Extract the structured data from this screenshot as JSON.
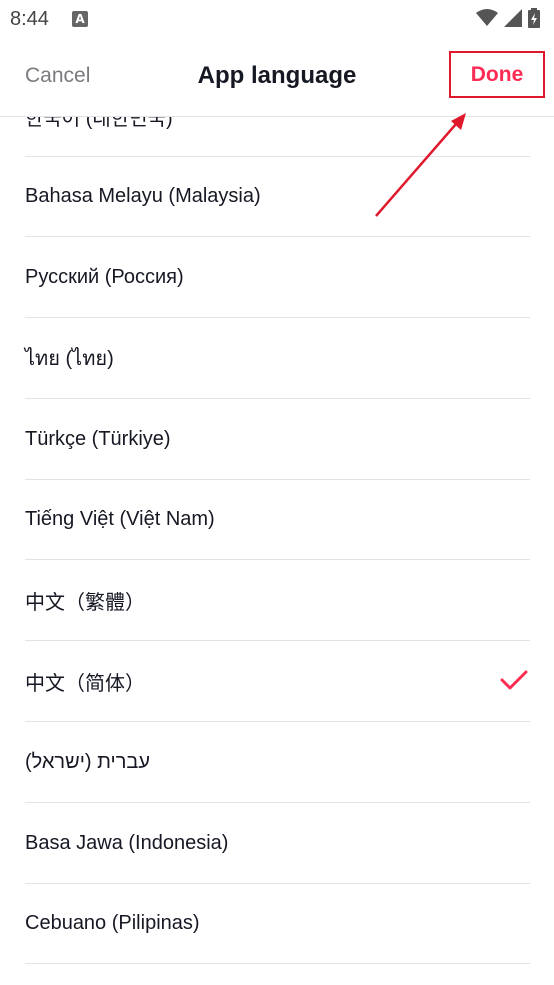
{
  "status_bar": {
    "time": "8:44",
    "notification_icon": "a-letter-icon",
    "icons": [
      "wifi-icon",
      "signal-icon",
      "battery-icon"
    ]
  },
  "header": {
    "cancel_label": "Cancel",
    "title": "App language",
    "done_label": "Done"
  },
  "languages": [
    {
      "label": "한국어 (대한민국)",
      "selected": false
    },
    {
      "label": "Bahasa Melayu (Malaysia)",
      "selected": false
    },
    {
      "label": "Русский (Россия)",
      "selected": false
    },
    {
      "label": "ไทย (ไทย)",
      "selected": false
    },
    {
      "label": "Türkçe (Türkiye)",
      "selected": false
    },
    {
      "label": "Tiếng Việt (Việt Nam)",
      "selected": false
    },
    {
      "label": "中文（繁體）",
      "selected": false
    },
    {
      "label": "中文（简体）",
      "selected": true
    },
    {
      "label": "עברית (ישראל)",
      "selected": false
    },
    {
      "label": "Basa Jawa (Indonesia)",
      "selected": false
    },
    {
      "label": "Cebuano (Pilipinas)",
      "selected": false
    }
  ],
  "colors": {
    "accent": "#fe2c55",
    "annotation": "#e0182c",
    "divider": "#e3e3e4"
  }
}
